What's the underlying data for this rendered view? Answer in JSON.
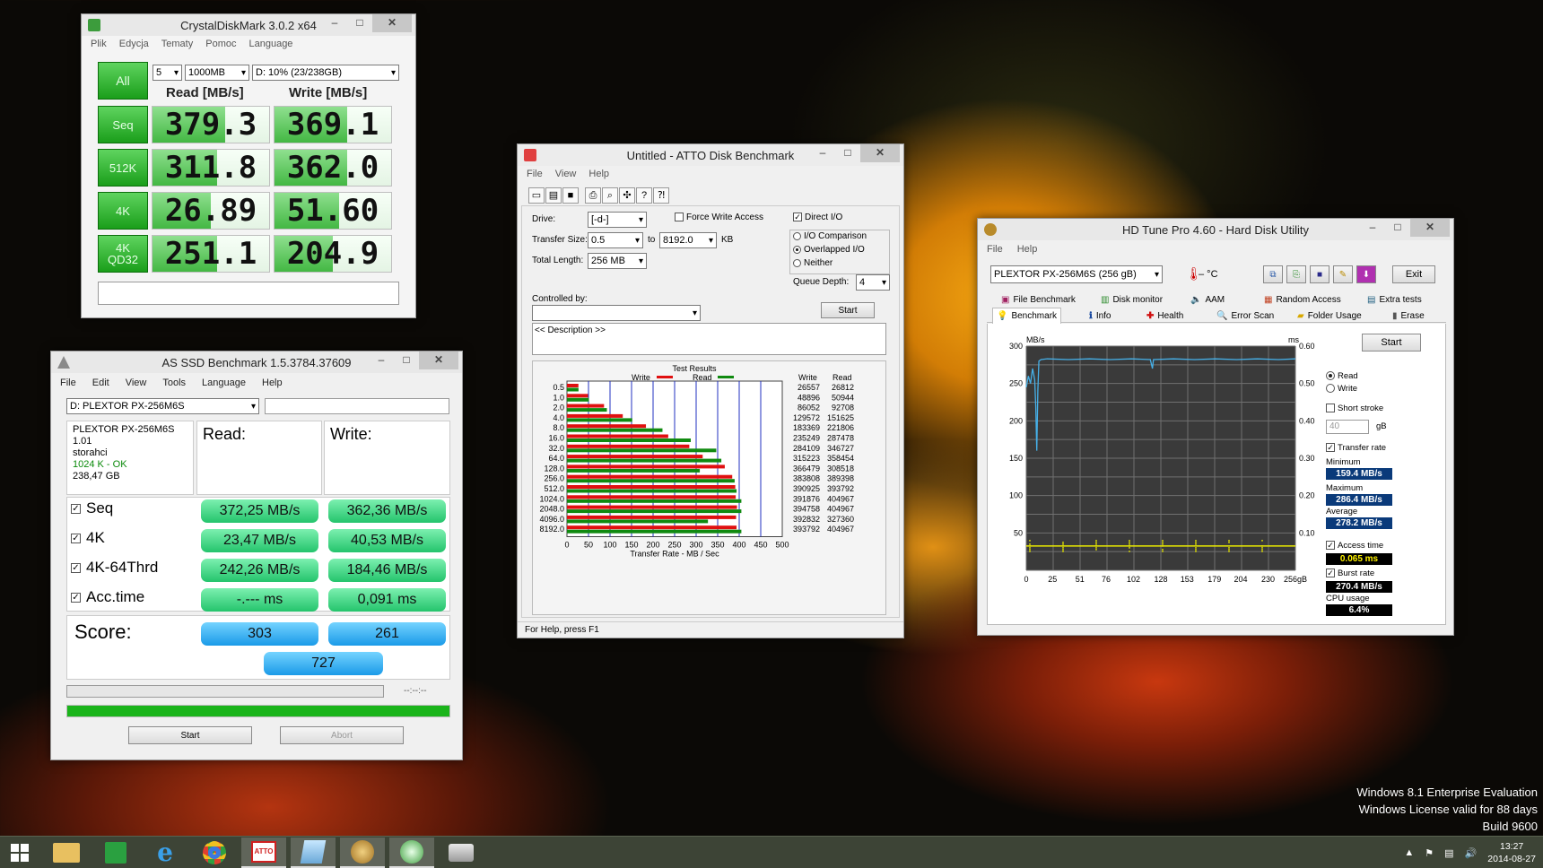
{
  "cdm": {
    "title": "CrystalDiskMark 3.0.2 x64",
    "menu": [
      "Plik",
      "Edycja",
      "Tematy",
      "Pomoc",
      "Language"
    ],
    "all_label": "All",
    "runs": "5",
    "size": "1000MB",
    "drive": "D: 10% (23/238GB)",
    "read_header": "Read [MB/s]",
    "write_header": "Write [MB/s]",
    "rows": [
      {
        "label": "Seq",
        "read": "379.3",
        "write": "369.1"
      },
      {
        "label": "512K",
        "read": "311.8",
        "write": "362.0"
      },
      {
        "label": "4K",
        "read": "26.89",
        "write": "51.60"
      },
      {
        "label": "4K\nQD32",
        "read": "251.1",
        "write": "204.9"
      }
    ],
    "bar_fractions": [
      [
        0.62,
        0.62
      ],
      [
        0.55,
        0.62
      ],
      [
        0.5,
        0.55
      ],
      [
        0.55,
        0.5
      ]
    ]
  },
  "asssd": {
    "title": "AS SSD Benchmark 1.5.3784.37609",
    "menu": [
      "File",
      "Edit",
      "View",
      "Tools",
      "Language",
      "Help"
    ],
    "drive_select": "D: PLEXTOR PX-256M6S",
    "info": [
      "PLEXTOR PX-256M6S",
      "1.01",
      "storahci",
      "1024 K - OK",
      "238,47 GB"
    ],
    "read_header": "Read:",
    "write_header": "Write:",
    "rows": [
      {
        "label": "Seq",
        "read": "372,25 MB/s",
        "write": "362,36 MB/s"
      },
      {
        "label": "4K",
        "read": "23,47 MB/s",
        "write": "40,53 MB/s"
      },
      {
        "label": "4K-64Thrd",
        "read": "242,26 MB/s",
        "write": "184,46 MB/s"
      },
      {
        "label": "Acc.time",
        "read": "-.--- ms",
        "write": "0,091 ms"
      }
    ],
    "checkmark": "✓",
    "score_label": "Score:",
    "score_read": "303",
    "score_write": "261",
    "score_total": "727",
    "timer": "--:--:--",
    "progress": 1.0,
    "start": "Start",
    "abort": "Abort"
  },
  "atto": {
    "title": "Untitled - ATTO Disk Benchmark",
    "menu": [
      "File",
      "View",
      "Help"
    ],
    "drive_label": "Drive:",
    "drive": "[-d-]",
    "force_write": "Force Write Access",
    "direct_io": "Direct I/O",
    "transfer_label": "Transfer Size:",
    "transfer_from": "0.5",
    "to_label": "to",
    "transfer_to": "8192.0",
    "kb": "KB",
    "total_label": "Total Length:",
    "total": "256 MB",
    "io_comparison": "I/O Comparison",
    "overlapped": "Overlapped I/O",
    "neither": "Neither",
    "queue_label": "Queue Depth:",
    "queue": "4",
    "controlled_label": "Controlled by:",
    "start": "Start",
    "description": "<< Description >>",
    "results_title": "Test Results",
    "write_legend": "Write",
    "read_legend": "Read",
    "col_write": "Write",
    "col_read": "Read",
    "x_ticks": [
      "0",
      "50",
      "100",
      "150",
      "200",
      "250",
      "300",
      "350",
      "400",
      "450",
      "500"
    ],
    "x_label": "Transfer Rate - MB / Sec",
    "status": "For Help, press F1",
    "colors": {
      "write": "#e01010",
      "read": "#108a10"
    },
    "chart_data": {
      "type": "bar",
      "categories": [
        "0.5",
        "1.0",
        "2.0",
        "4.0",
        "8.0",
        "16.0",
        "32.0",
        "64.0",
        "128.0",
        "256.0",
        "512.0",
        "1024.0",
        "2048.0",
        "4096.0",
        "8192.0"
      ],
      "series": [
        {
          "name": "Write",
          "values": [
            26.6,
            48.9,
            86.1,
            129.6,
            183.4,
            235.2,
            284.1,
            315.2,
            366.5,
            383.8,
            390.9,
            391.9,
            394.8,
            392.8,
            393.8
          ]
        },
        {
          "name": "Read",
          "values": [
            26.8,
            50.9,
            92.7,
            151.6,
            221.8,
            287.5,
            346.7,
            358.5,
            308.5,
            389.4,
            393.8,
            405.0,
            405.0,
            327.4,
            405.0
          ]
        }
      ],
      "write_text": [
        "26557",
        "48896",
        "86052",
        "129572",
        "183369",
        "235249",
        "284109",
        "315223",
        "366479",
        "383808",
        "390925",
        "391876",
        "394758",
        "392832",
        "393792"
      ],
      "read_text": [
        "26812",
        "50944",
        "92708",
        "151625",
        "221806",
        "287478",
        "346727",
        "358454",
        "308518",
        "389398",
        "393792",
        "404967",
        "404967",
        "327360",
        "404967"
      ],
      "xlim": [
        0,
        500
      ]
    }
  },
  "hdtune": {
    "title": "HD Tune Pro 4.60 - Hard Disk Utility",
    "menu": [
      "File",
      "Help"
    ],
    "drive": "PLEXTOR PX-256M6S (256 gB)",
    "temp": "– °C",
    "exit": "Exit",
    "tabs_top": [
      "File Benchmark",
      "Disk monitor",
      "AAM",
      "Random Access",
      "Extra tests"
    ],
    "tabs_bottom": [
      "Benchmark",
      "Info",
      "Health",
      "Error Scan",
      "Folder Usage",
      "Erase"
    ],
    "start": "Start",
    "read": "Read",
    "write": "Write",
    "short_stroke": "Short stroke",
    "stroke_value": "40",
    "gb": "gB",
    "transfer_rate": "Transfer rate",
    "minimum_label": "Minimum",
    "minimum": "159.4 MB/s",
    "maximum_label": "Maximum",
    "maximum": "286.4 MB/s",
    "average_label": "Average",
    "average": "278.2 MB/s",
    "access_time": "Access time",
    "access_value": "0.065 ms",
    "burst_rate": "Burst rate",
    "burst_value": "270.4 MB/s",
    "cpu_label": "CPU usage",
    "cpu_value": "6.4%",
    "checkmark": "✓",
    "chart_data": {
      "type": "line",
      "y_unit": "MB/s",
      "y2_unit": "ms",
      "y_ticks": [
        "300",
        "250",
        "200",
        "150",
        "100",
        "50"
      ],
      "y2_ticks": [
        "0.60",
        "0.50",
        "0.40",
        "0.30",
        "0.20",
        "0.10"
      ],
      "x_ticks": [
        "0",
        "25",
        "51",
        "76",
        "102",
        "128",
        "153",
        "179",
        "204",
        "230",
        "256gB"
      ],
      "ylim": [
        0,
        300
      ],
      "y2lim": [
        0,
        0.6
      ],
      "xlim": [
        0,
        256
      ],
      "transfer_series": [
        [
          0,
          245
        ],
        [
          2,
          260
        ],
        [
          4,
          250
        ],
        [
          6,
          270
        ],
        [
          8,
          255
        ],
        [
          9,
          220
        ],
        [
          10,
          160
        ],
        [
          11,
          240
        ],
        [
          12,
          280
        ],
        [
          14,
          282
        ],
        [
          20,
          283
        ],
        [
          40,
          282
        ],
        [
          60,
          283
        ],
        [
          80,
          282
        ],
        [
          100,
          283
        ],
        [
          118,
          282
        ],
        [
          120,
          270
        ],
        [
          121,
          282
        ],
        [
          140,
          283
        ],
        [
          160,
          282
        ],
        [
          180,
          283
        ],
        [
          200,
          282
        ],
        [
          220,
          283
        ],
        [
          240,
          282
        ],
        [
          256,
          283
        ]
      ],
      "access_ms": 0.065
    }
  },
  "watermark": [
    "Windows 8.1 Enterprise Evaluation",
    "Windows License valid for 88 days",
    "Build 9600"
  ],
  "tray": {
    "time": "13:27",
    "date": "2014-08-27"
  }
}
